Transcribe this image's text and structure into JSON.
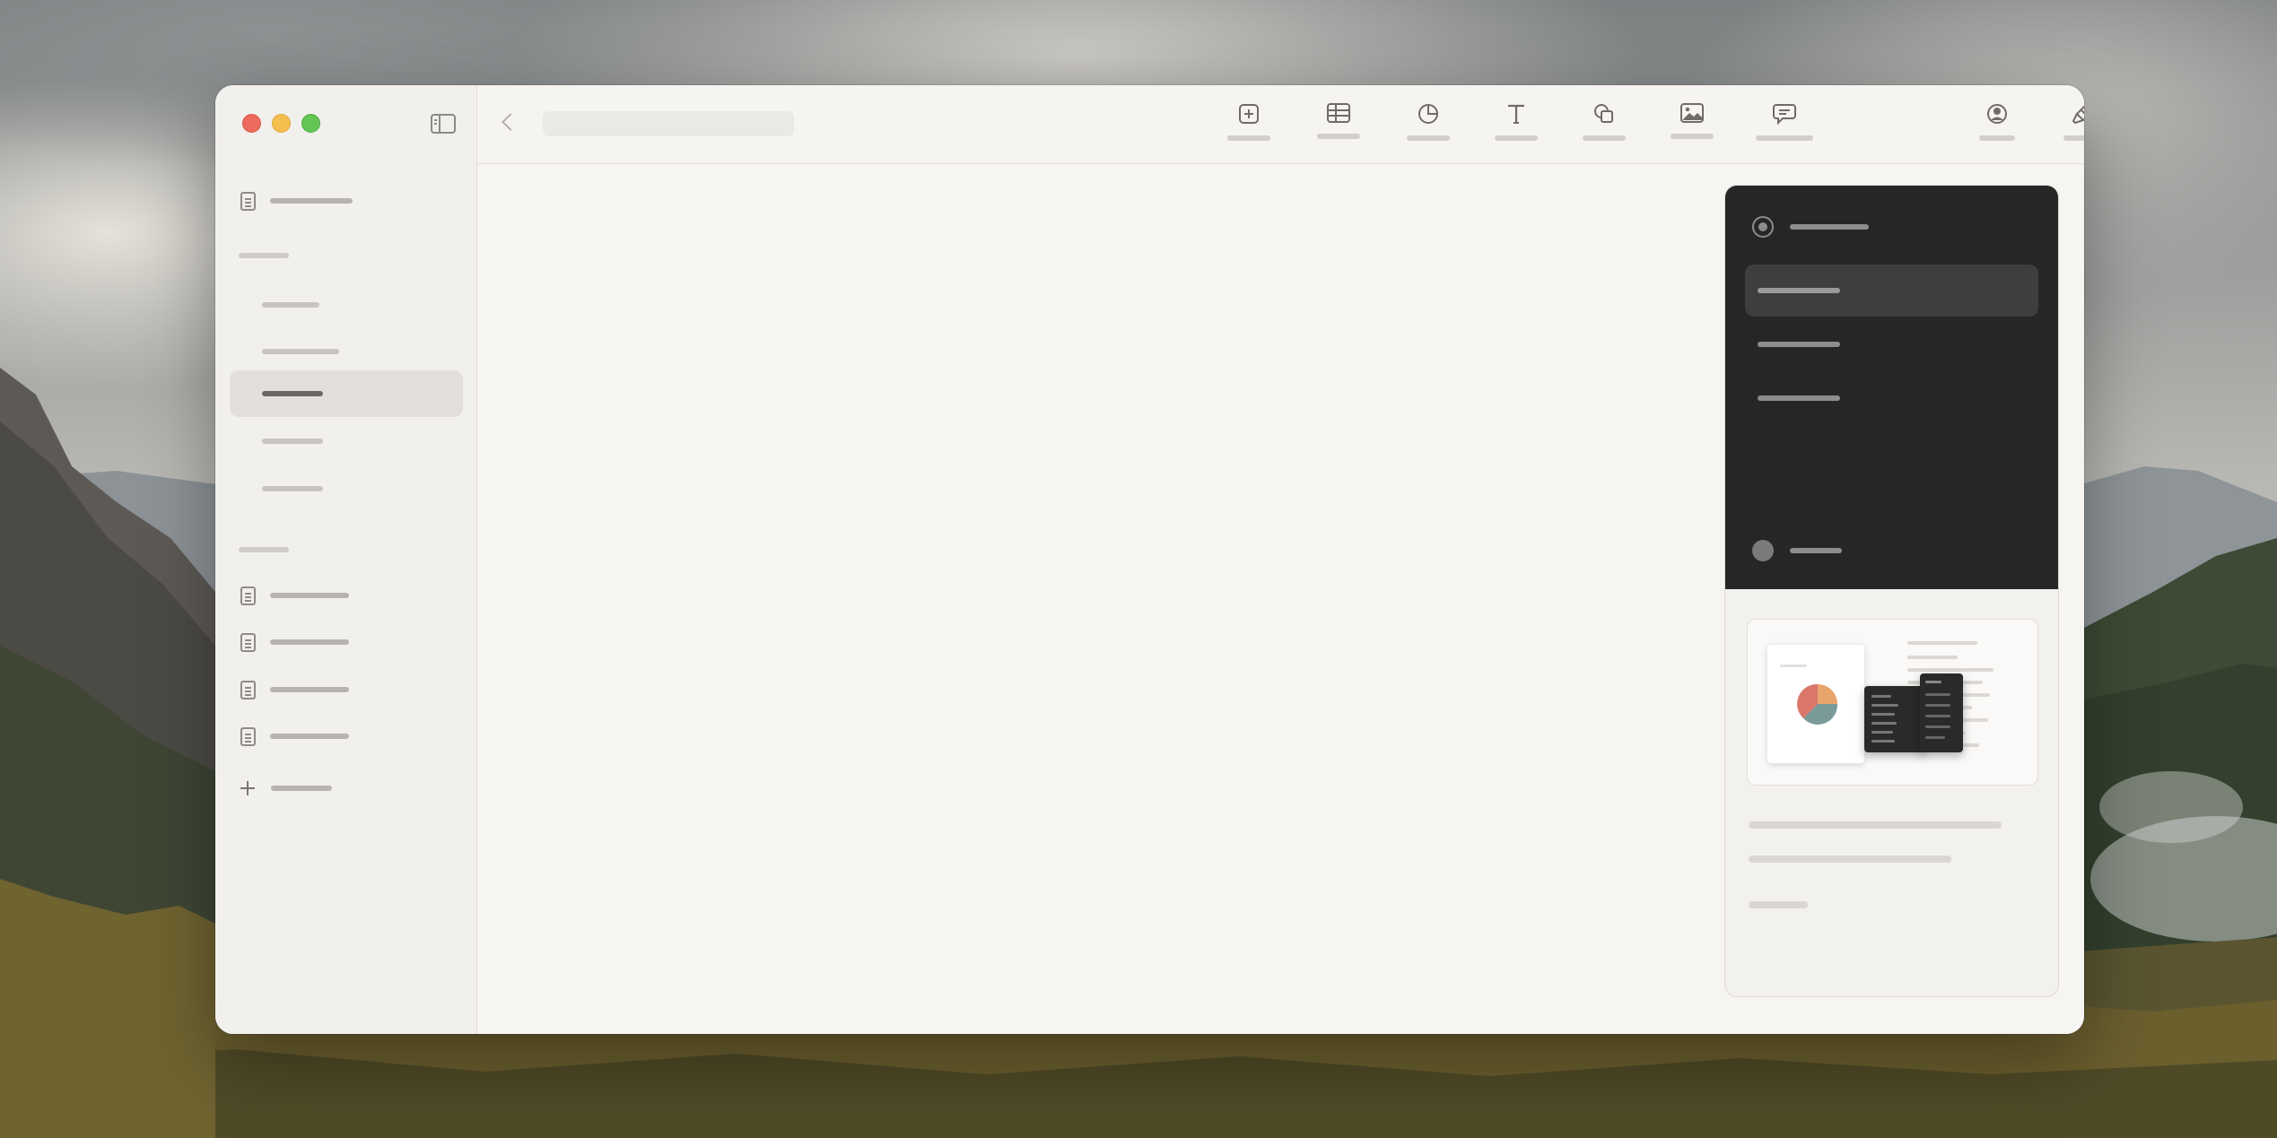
{
  "app": {
    "window_controls": [
      "close",
      "minimize",
      "zoom"
    ],
    "title": ""
  },
  "sidebar": {
    "toggle_icon": "sidebar-toggle-icon",
    "top_item": {
      "label": "",
      "icon": "document-icon"
    },
    "sections": [
      {
        "header": "",
        "pages": [
          {
            "label": "",
            "selected": false
          },
          {
            "label": "",
            "selected": false
          },
          {
            "label": "",
            "selected": true
          },
          {
            "label": "",
            "selected": false
          },
          {
            "label": "",
            "selected": false
          }
        ]
      },
      {
        "header": "",
        "documents": [
          {
            "label": "",
            "icon": "document-icon"
          },
          {
            "label": "",
            "icon": "document-icon"
          },
          {
            "label": "",
            "icon": "document-icon"
          },
          {
            "label": "",
            "icon": "document-icon"
          }
        ]
      }
    ],
    "add_item": {
      "label": "",
      "icon": "plus-icon"
    }
  },
  "toolbar": {
    "back_icon": "chevron-left-icon",
    "title_field": "",
    "insert_tools": [
      {
        "name": "add-page",
        "icon": "plus-square-icon",
        "label": ""
      },
      {
        "name": "table",
        "icon": "table-icon",
        "label": ""
      },
      {
        "name": "chart",
        "icon": "chart-icon",
        "label": ""
      },
      {
        "name": "text",
        "icon": "text-icon",
        "label": ""
      },
      {
        "name": "shape",
        "icon": "shape-icon",
        "label": ""
      },
      {
        "name": "media",
        "icon": "image-icon",
        "label": ""
      },
      {
        "name": "comment",
        "icon": "comment-icon",
        "label": ""
      }
    ],
    "right_tools": [
      {
        "name": "collaborate",
        "icon": "collaborate-icon",
        "label": ""
      },
      {
        "name": "format",
        "icon": "paintbrush-icon",
        "label": ""
      },
      {
        "name": "animate",
        "icon": "diamond-icon",
        "label": ""
      },
      {
        "name": "document",
        "icon": "document-panel-icon",
        "label": ""
      }
    ]
  },
  "panel": {
    "header": {
      "icon": "target-icon",
      "label": ""
    },
    "options": [
      {
        "label": "",
        "active": true
      },
      {
        "label": "",
        "active": false
      },
      {
        "label": "",
        "active": false
      }
    ],
    "footer": {
      "label": ""
    },
    "preview": {
      "description_lines": [
        "",
        ""
      ],
      "link": ""
    }
  },
  "colors": {
    "close": "#ed6a5e",
    "minimize": "#f5bf4f",
    "zoom": "#62c554",
    "panel_dark": "#262626",
    "canvas": "#f7f5f2",
    "pie_orange": "#e9a46b",
    "pie_red": "#d9776a",
    "pie_teal": "#7a9a9a"
  }
}
